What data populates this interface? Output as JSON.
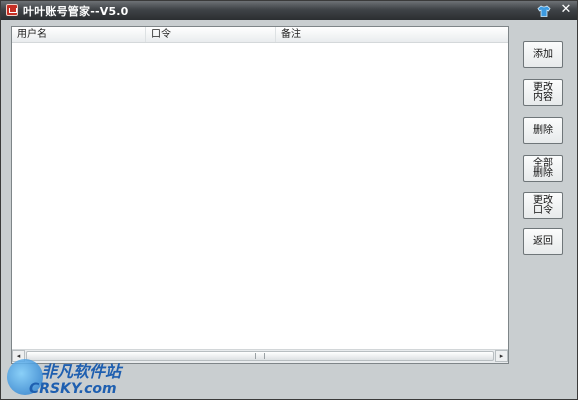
{
  "window": {
    "title": "叶叶账号管家--V5.0",
    "app_icon": "app-icon",
    "skin_icon": "shirt-icon",
    "close_label": "✕"
  },
  "list": {
    "columns": [
      "用户名",
      "口令",
      "备注"
    ],
    "rows": []
  },
  "buttons": {
    "add": "添加",
    "edit_content": "更改内容",
    "delete": "删除",
    "delete_all": "全部删除",
    "change_password": "更改口令",
    "back": "返回"
  },
  "watermark": {
    "cn": "非凡软件站",
    "en": "CRSKY.com"
  },
  "colors": {
    "titlebar": "#3f4347",
    "window_bg": "#c9ced0",
    "list_bg": "#ffffff",
    "watermark": "#1e5fb0"
  }
}
